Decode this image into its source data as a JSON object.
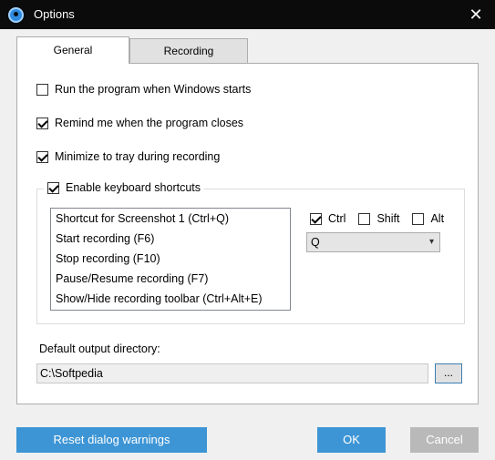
{
  "window": {
    "title": "Options",
    "close_glyph": "✕"
  },
  "tabs": [
    {
      "label": "General",
      "selected": true
    },
    {
      "label": "Recording",
      "selected": false
    }
  ],
  "general": {
    "options": [
      {
        "label": "Run the program when Windows starts",
        "checked": false
      },
      {
        "label": "Remind me when the program closes",
        "checked": true
      },
      {
        "label": "Minimize to tray during recording",
        "checked": true
      }
    ],
    "shortcuts_group": {
      "label": "Enable keyboard shortcuts",
      "checked": true,
      "items": [
        "Shortcut for Screenshot 1 (Ctrl+Q)",
        "Start recording (F6)",
        "Stop recording (F10)",
        "Pause/Resume recording (F7)",
        "Show/Hide recording toolbar (Ctrl+Alt+E)"
      ],
      "modifiers": [
        {
          "label": "Ctrl",
          "checked": true
        },
        {
          "label": "Shift",
          "checked": false
        },
        {
          "label": "Alt",
          "checked": false
        }
      ],
      "key_value": "Q",
      "key_chevron": "▾"
    },
    "output_directory": {
      "label": "Default output directory:",
      "value": "C:\\Softpedia",
      "browse_label": "..."
    }
  },
  "footer": {
    "reset_label": "Reset dialog warnings",
    "ok_label": "OK",
    "cancel_label": "Cancel"
  },
  "colors": {
    "titlebar": "#0b0b0b",
    "primary_button": "#3d95d5",
    "disabled_button": "#b9b9b9"
  }
}
